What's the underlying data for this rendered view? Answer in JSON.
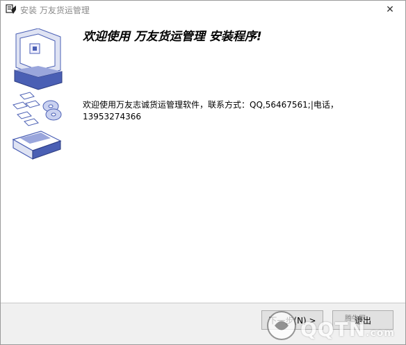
{
  "window": {
    "title": "安装 万友货运管理",
    "close_glyph": "✕"
  },
  "content": {
    "heading": "欢迎使用 万友货运管理 安装程序!",
    "description": "欢迎使用万友志诚货运管理软件，联系方式：QQ,56467561;|电话，13953274366"
  },
  "footer": {
    "next_label": "下一步(N) >",
    "exit_label": "退出"
  },
  "watermark": {
    "text": "QQTN",
    "sub": "腾牛网",
    "domain": ".com"
  },
  "colors": {
    "background": "#2f6f9e",
    "panel": "#f0f0f0",
    "button_face": "#e1e1e1",
    "graphic_blue": "#4a5fb4"
  }
}
